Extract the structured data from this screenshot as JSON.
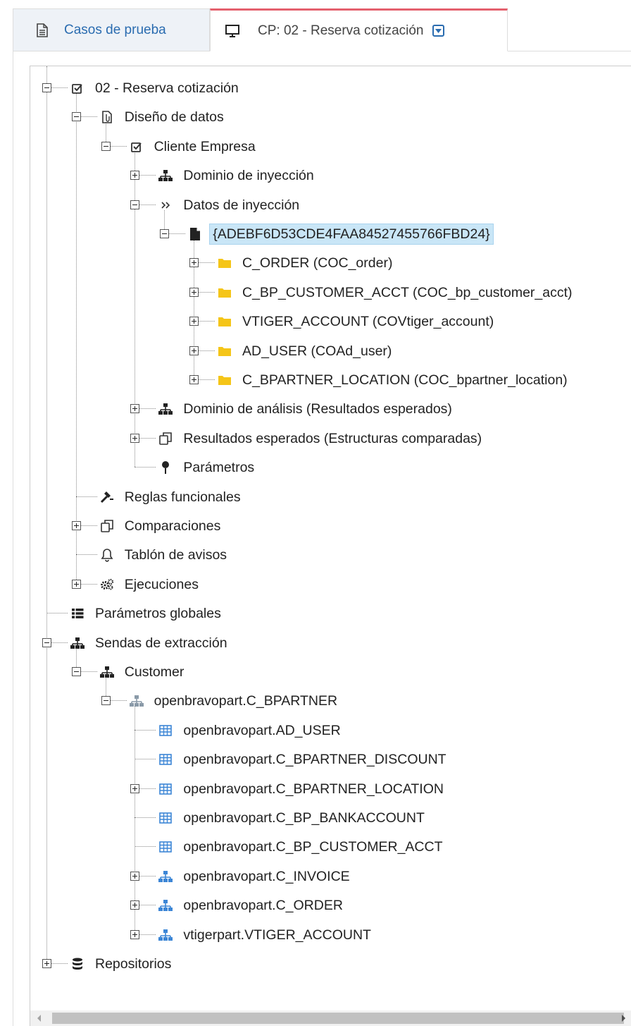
{
  "tabs": [
    {
      "label": "Casos de prueba",
      "icon": "document-icon",
      "active": false
    },
    {
      "label": "CP: 02 - Reserva cotización",
      "icon": "monitor-icon",
      "active": true
    }
  ],
  "colors": {
    "accent": "#2a6cb0",
    "active_tab_border": "#e4606d",
    "selection_bg": "#c9e6f7",
    "folder": "#f5c518",
    "table_icon": "#3c86d6"
  },
  "tree": [
    {
      "label": "02 - Reserva cotización",
      "icon": "checkbox-checked-icon",
      "depth": 0,
      "expander": "minus"
    },
    {
      "label": "Diseño de datos",
      "icon": "document-clip-icon",
      "depth": 1,
      "expander": "minus"
    },
    {
      "label": "Cliente Empresa",
      "icon": "checkbox-checked-icon",
      "depth": 2,
      "expander": "minus"
    },
    {
      "label": "Dominio de inyección",
      "icon": "sitemap-icon",
      "depth": 3,
      "expander": "plus"
    },
    {
      "label": "Datos de inyección",
      "icon": "double-chevron-right-icon",
      "depth": 3,
      "expander": "minus"
    },
    {
      "label": "{ADEBF6D53CDE4FAA84527455766FBD24}",
      "icon": "file-icon",
      "depth": 4,
      "expander": "minus",
      "selected": true
    },
    {
      "label": "C_ORDER (COC_order)",
      "icon": "folder-icon",
      "depth": 5,
      "expander": "plus"
    },
    {
      "label": "C_BP_CUSTOMER_ACCT (COC_bp_customer_acct)",
      "icon": "folder-icon",
      "depth": 5,
      "expander": "plus"
    },
    {
      "label": "VTIGER_ACCOUNT (COVtiger_account)",
      "icon": "folder-icon",
      "depth": 5,
      "expander": "plus"
    },
    {
      "label": "AD_USER (COAd_user)",
      "icon": "folder-icon",
      "depth": 5,
      "expander": "plus"
    },
    {
      "label": "C_BPARTNER_LOCATION (COC_bpartner_location)",
      "icon": "folder-icon",
      "depth": 5,
      "expander": "plus"
    },
    {
      "label": "Dominio de análisis (Resultados esperados)",
      "icon": "sitemap-icon",
      "depth": 3,
      "expander": "plus"
    },
    {
      "label": "Resultados esperados (Estructuras comparadas)",
      "icon": "copy-icon",
      "depth": 3,
      "expander": "plus"
    },
    {
      "label": "Parámetros",
      "icon": "pin-icon",
      "depth": 3,
      "expander": "none"
    },
    {
      "label": "Reglas funcionales",
      "icon": "gavel-icon",
      "depth": 1,
      "expander": "none"
    },
    {
      "label": "Comparaciones",
      "icon": "copy-icon",
      "depth": 1,
      "expander": "plus"
    },
    {
      "label": "Tablón de avisos",
      "icon": "bell-icon",
      "depth": 1,
      "expander": "none"
    },
    {
      "label": "Ejecuciones",
      "icon": "gears-icon",
      "depth": 1,
      "expander": "plus"
    },
    {
      "label": "Parámetros globales",
      "icon": "list-icon",
      "depth": 0,
      "expander": "none"
    },
    {
      "label": "Sendas de extracción",
      "icon": "sitemap-icon",
      "depth": 0,
      "expander": "minus"
    },
    {
      "label": "Customer",
      "icon": "sitemap-icon",
      "depth": 1,
      "expander": "minus"
    },
    {
      "label": "openbravopart.C_BPARTNER",
      "icon": "sitemap-gray-icon",
      "depth": 2,
      "expander": "minus"
    },
    {
      "label": "openbravopart.AD_USER",
      "icon": "table-icon",
      "depth": 3,
      "expander": "none"
    },
    {
      "label": "openbravopart.C_BPARTNER_DISCOUNT",
      "icon": "table-icon",
      "depth": 3,
      "expander": "none"
    },
    {
      "label": "openbravopart.C_BPARTNER_LOCATION",
      "icon": "table-icon",
      "depth": 3,
      "expander": "plus"
    },
    {
      "label": "openbravopart.C_BP_BANKACCOUNT",
      "icon": "table-icon",
      "depth": 3,
      "expander": "none"
    },
    {
      "label": "openbravopart.C_BP_CUSTOMER_ACCT",
      "icon": "table-icon",
      "depth": 3,
      "expander": "none"
    },
    {
      "label": "openbravopart.C_INVOICE",
      "icon": "sitemap-blue-icon",
      "depth": 3,
      "expander": "plus"
    },
    {
      "label": "openbravopart.C_ORDER",
      "icon": "sitemap-blue-icon",
      "depth": 3,
      "expander": "plus"
    },
    {
      "label": "vtigerpart.VTIGER_ACCOUNT",
      "icon": "sitemap-blue-icon",
      "depth": 3,
      "expander": "plus"
    },
    {
      "label": "Repositorios",
      "icon": "database-icon",
      "depth": 0,
      "expander": "plus"
    }
  ]
}
